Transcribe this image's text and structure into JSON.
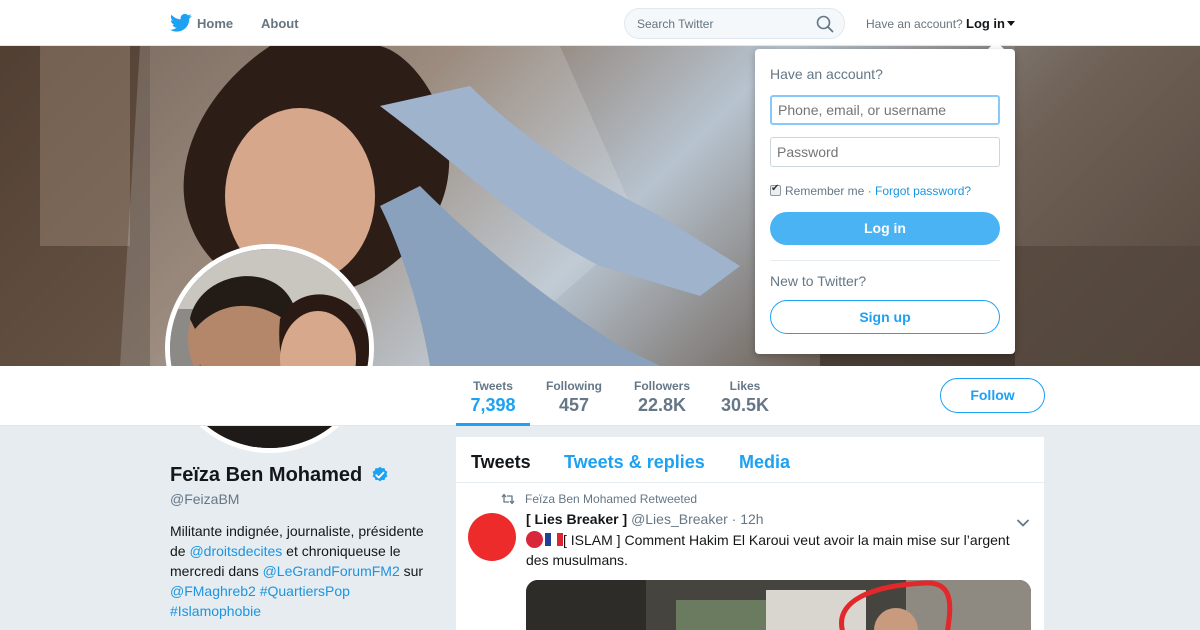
{
  "nav": {
    "home": "Home",
    "about": "About",
    "search_placeholder": "Search Twitter",
    "have_account": "Have an account?",
    "login": "Log in",
    "logo_icon": "twitter-bird-icon",
    "search_icon": "search-icon",
    "caret_icon": "caret-down-icon"
  },
  "stats": [
    {
      "label": "Tweets",
      "value": "7,398",
      "active": true
    },
    {
      "label": "Following",
      "value": "457",
      "active": false
    },
    {
      "label": "Followers",
      "value": "22.8K",
      "active": false
    },
    {
      "label": "Likes",
      "value": "30.5K",
      "active": false
    }
  ],
  "follow_label": "Follow",
  "profile": {
    "name": "Feïza Ben Mohamed",
    "handle": "@FeizaBM",
    "verified_icon": "verified-badge-icon",
    "bio": {
      "t1": "Militante indignée, journaliste, présidente de ",
      "link1": "@droitsdecites",
      "t2": " et chroniqueuse le mercredi dans ",
      "link2": "@LeGrandForumFM2",
      "t3": " sur ",
      "link3": "@FMaghreb2",
      "t4": " ",
      "link4": "#QuartiersPop",
      "link5": "#Islamophobie"
    }
  },
  "timeline": {
    "tabs": [
      "Tweets",
      "Tweets & replies",
      "Media"
    ],
    "retweet_text": "Feïza Ben Mohamed Retweeted",
    "retweet_icon": "retweet-icon",
    "chevron_icon": "chevron-down-icon",
    "tweet": {
      "name": "[ Lies Breaker ]",
      "handle": "@Lies_Breaker",
      "sep": "·",
      "time": "12h",
      "text": "[ ISLAM ] Comment Hakim El Karoui veut avoir la main mise sur l’argent des musulmans.",
      "emoji_icons": [
        "red-circle-icon",
        "france-flag-icon"
      ]
    }
  },
  "login_dropdown": {
    "title": "Have an account?",
    "username_placeholder": "Phone, email, or username",
    "password_placeholder": "Password",
    "remember": "Remember me",
    "separator": "·",
    "forgot": "Forgot password?",
    "login_button": "Log in",
    "new_to": "New to Twitter?",
    "signup_button": "Sign up"
  },
  "colors": {
    "brand_blue": "#1da1f2",
    "link_blue": "#1b95e0",
    "login_button_blue": "#4ab3f4",
    "page_bg": "#e6ecf0"
  }
}
